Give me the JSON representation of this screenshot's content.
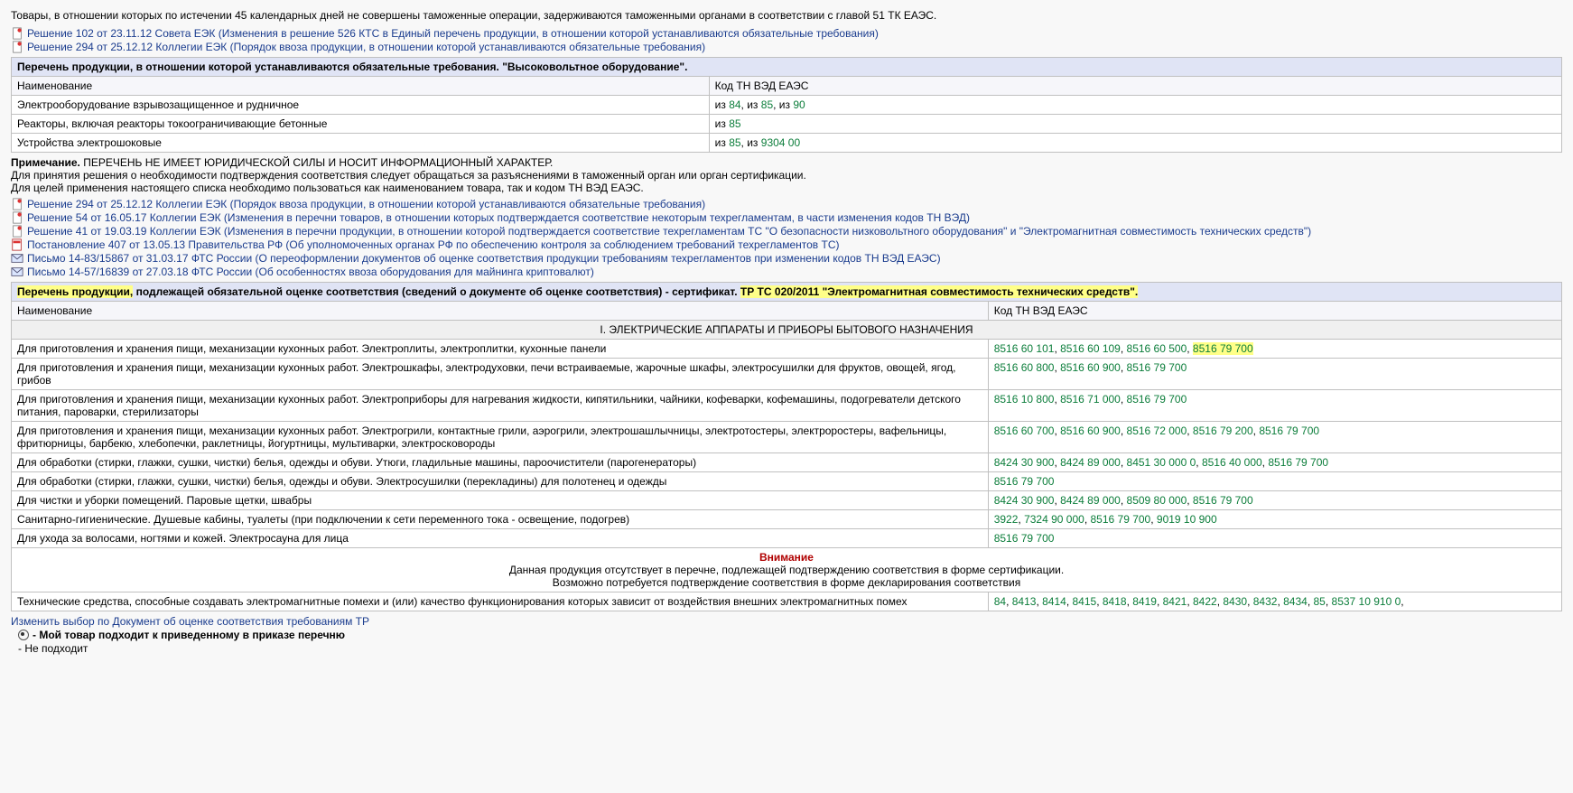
{
  "intro_para": "Товары, в отношении которых по истечении 45 календарных дней не совершены таможенные операции, задерживаются таможенными органами в соответствии с главой 51 ТК ЕАЭС.",
  "top_links": [
    {
      "icon": "doc",
      "text": "Решение 102 от 23.11.12 Совета ЕЭК (Изменения в решение 526 КТС в Единый перечень продукции, в отношении которой устанавливаются обязательные требования)"
    },
    {
      "icon": "doc",
      "text": "Решение 294 от 25.12.12 Коллегии ЕЭК (Порядок ввоза продукции, в отношении которой устанавливаются обязательные требования)"
    }
  ],
  "table1": {
    "title": "Перечень продукции, в отношении которой устанавливаются обязательные требования. \"Высоковольтное оборудование\".",
    "col_name": "Наименование",
    "col_code": "Код ТН ВЭД ЕАЭС",
    "rows": [
      {
        "name": "Электрооборудование взрывозащищенное и рудничное",
        "codes": [
          "84",
          "85",
          "90"
        ],
        "sep": "из "
      },
      {
        "name": "Реакторы, включая реакторы токоограничивающие бетонные",
        "codes": [
          "85"
        ],
        "sep": "из "
      },
      {
        "name": "Устройства электрошоковые",
        "codes": [
          "85",
          "9304 00"
        ],
        "sep": "из "
      }
    ]
  },
  "note_block": {
    "strong": "Примечание.",
    "line1": " ПЕРЕЧЕНЬ НЕ ИМЕЕТ ЮРИДИЧЕСКОЙ СИЛЫ И НОСИТ ИНФОРМАЦИОННЫЙ ХАРАКТЕР.",
    "line2": "Для принятия решения о необходимости подтверждения соответствия следует обращаться за разъяснениями в таможенный орган или орган сертификации.",
    "line3": "Для целей применения настоящего списка необходимо пользоваться как наименованием товара, так и кодом ТН ВЭД ЕАЭС."
  },
  "mid_links": [
    {
      "icon": "doc",
      "text": "Решение 294 от 25.12.12 Коллегии ЕЭК (Порядок ввоза продукции, в отношении которой устанавливаются обязательные требования)"
    },
    {
      "icon": "doc",
      "text": "Решение 54 от 16.05.17 Коллегии ЕЭК (Изменения в перечни товаров, в отношении которых подтверждается соответствие некоторым техрегламентам, в части изменения кодов ТН ВЭД)"
    },
    {
      "icon": "doc",
      "text": "Решение 41 от 19.03.19 Коллегии ЕЭК (Изменения в перечни продукции, в отношении которой подтверждается соответствие техрегламентам ТС \"О безопасности низковольтного оборудования\" и \"Электромагнитная совместимость технических средств\")"
    },
    {
      "icon": "pdf",
      "text": "Постановление 407 от 13.05.13 Правительства РФ (Об уполномоченных органах РФ по обеспечению контроля за соблюдением требований техрегламентов ТС)"
    },
    {
      "icon": "mail",
      "text": "Письмо 14-83/15867 от 31.03.17 ФТС России (О переоформлении документов об оценке соответствия продукции требованиям техрегламентов при изменении кодов ТН ВЭД ЕАЭС)"
    },
    {
      "icon": "mail",
      "text": "Письмо 14-57/16839 от 27.03.18 ФТС России (Об особенностях ввоза оборудования для майнинга криптовалют)"
    }
  ],
  "table2": {
    "title_pre": "Перечень продукции,",
    "title_mid": " подлежащей обязательной оценке соответствия (сведений о документе об оценке соответствия) - сертификат. ",
    "title_hl": "ТР ТС 020/2011 \"Электромагнитная совместимость технических средств\".",
    "col_name": "Наименование",
    "col_code": "Код ТН ВЭД ЕАЭС",
    "section": "I. ЭЛЕКТРИЧЕСКИЕ АППАРАТЫ И ПРИБОРЫ БЫТОВОГО НАЗНАЧЕНИЯ",
    "rows": [
      {
        "name": "Для приготовления и хранения пищи, механизации кухонных работ. Электроплиты, электроплитки, кухонные панели",
        "codes": [
          "8516 60 101",
          "8516 60 109",
          "8516 60 500",
          "8516 79 700"
        ],
        "hl_last": true
      },
      {
        "name": "Для приготовления и хранения пищи, механизации кухонных работ. Электрошкафы, электродуховки, печи встраиваемые, жарочные шкафы, электросушилки для фруктов, овощей, ягод, грибов",
        "codes": [
          "8516 60 800",
          "8516 60 900",
          "8516 79 700"
        ]
      },
      {
        "name": "Для приготовления и хранения пищи, механизации кухонных работ. Электроприборы для нагревания жидкости, кипятильники, чайники, кофеварки, кофемашины, подогреватели детского питания, пароварки, стерилизаторы",
        "codes": [
          "8516 10 800",
          "8516 71 000",
          "8516 79 700"
        ]
      },
      {
        "name": "Для приготовления и хранения пищи, механизации кухонных работ. Электрогрили, контактные грили, аэрогрили, электрошашлычницы, электротостеры, электроростеры, вафельницы, фритюрницы, барбекю, хлебопечки, раклетницы, йогуртницы, мультиварки, электросковороды",
        "codes": [
          "8516 60 700",
          "8516 60 900",
          "8516 72 000",
          "8516 79 200",
          "8516 79 700"
        ]
      },
      {
        "name": "Для обработки (стирки, глажки, сушки, чистки) белья, одежды и обуви. Утюги, гладильные машины, пароочистители (парогенераторы)",
        "codes": [
          "8424 30 900",
          "8424 89 000",
          "8451 30 000 0",
          "8516 40 000",
          "8516 79 700"
        ]
      },
      {
        "name": "Для обработки (стирки, глажки, сушки, чистки) белья, одежды и обуви. Электросушилки (перекладины) для полотенец и одежды",
        "codes": [
          "8516 79 700"
        ]
      },
      {
        "name": "Для чистки и уборки помещений. Паровые щетки, швабры",
        "codes": [
          "8424 30 900",
          "8424 89 000",
          "8509 80 000",
          "8516 79 700"
        ]
      },
      {
        "name": "Санитарно-гигиенические. Душевые кабины, туалеты (при подключении к сети переменного тока - освещение, подогрев)",
        "codes": [
          "3922",
          "7324 90 000",
          "8516 79 700",
          "9019 10 900"
        ]
      },
      {
        "name": "Для ухода за волосами, ногтями и кожей. Электросауна для лица",
        "codes": [
          "8516 79 700"
        ]
      }
    ],
    "warn_title": "Внимание",
    "warn_l1": "Данная продукция отсутствует в перечне, подлежащей подтверждению соответствия в форме сертификации.",
    "warn_l2": "Возможно потребуется подтверждение соответствия в форме декларирования соответствия",
    "last_row": {
      "name": "Технические средства, способные создавать электромагнитные помехи и (или) качество функционирования которых зависит от воздействия внешних электромагнитных помех",
      "codes": [
        "84",
        "8413",
        "8414",
        "8415",
        "8418",
        "8419",
        "8421",
        "8422",
        "8430",
        "8432",
        "8434",
        "85",
        "8537 10 910 0"
      ],
      "trail": ", "
    }
  },
  "footer": {
    "change": "Изменить выбор по Документ об оценке соответствия требованиям ТР",
    "opt1": " - Мой товар подходит к приведенному в приказе перечню",
    "opt2": " - Не подходит"
  }
}
